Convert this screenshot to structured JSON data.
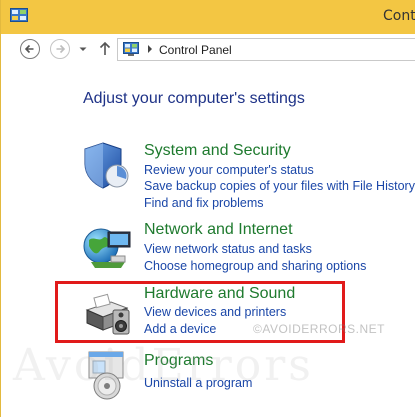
{
  "window": {
    "title": "Cont"
  },
  "navbar": {
    "breadcrumb": "Control Panel"
  },
  "main": {
    "heading": "Adjust your computer's settings",
    "categories": [
      {
        "title": "System and Security",
        "icon": "shield-icon",
        "links": [
          "Review your computer's status",
          "Save backup copies of your files with File History",
          "Find and fix problems"
        ]
      },
      {
        "title": "Network and Internet",
        "icon": "globe-network-icon",
        "links": [
          "View network status and tasks",
          "Choose homegroup and sharing options"
        ]
      },
      {
        "title": "Hardware and Sound",
        "icon": "printer-speaker-icon",
        "links": [
          "View devices and printers",
          "Add a device"
        ]
      },
      {
        "title": "Programs",
        "icon": "programs-disc-icon",
        "links": [
          "Uninstall a program"
        ]
      }
    ]
  },
  "watermark": {
    "small": "©AVOIDERRORS.NET",
    "large": "AvoidErrors"
  },
  "colors": {
    "titlebar": "#f3c643",
    "heading": "#1e3287",
    "category_title": "#1e7a2e",
    "link": "#1b47a8",
    "highlight_box": "#e11a1a"
  }
}
